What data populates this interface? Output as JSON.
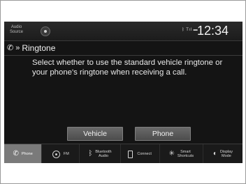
{
  "status": {
    "audio_source_line1": "Audio",
    "audio_source_line2": "Source",
    "indicators": "ᛒ Tıl ▬",
    "clock": "12:34"
  },
  "header": {
    "breadcrumb_icon": "phone-icon",
    "title": "Ringtone"
  },
  "message": "Select whether to use the standard vehicle ringtone or your phone's ringtone when receiving a call.",
  "buttons": {
    "vehicle": "Vehicle",
    "phone": "Phone"
  },
  "nav": [
    {
      "icon": "phone-icon",
      "label": "Phone",
      "active": true
    },
    {
      "icon": "radio-icon",
      "label": "FM",
      "active": false
    },
    {
      "icon": "bluetooth-icon",
      "label": "Bluetooth Audio",
      "active": false
    },
    {
      "icon": "smartphone-icon",
      "label": "Connect",
      "active": false
    },
    {
      "icon": "smart-shortcuts-icon",
      "label": "Smart Shortcuts",
      "active": false
    },
    {
      "icon": "display-mode-icon",
      "label": "Display Mode",
      "active": false
    }
  ],
  "nav_labels": {
    "phone": "Phone",
    "fm": "FM",
    "bluetooth_line1": "Bluetooth",
    "bluetooth_line2": "Audio",
    "connect": "Connect",
    "shortcuts_line1": "Smart",
    "shortcuts_line2": "Shortcuts",
    "display_line1": "Display",
    "display_line2": "Mode"
  }
}
